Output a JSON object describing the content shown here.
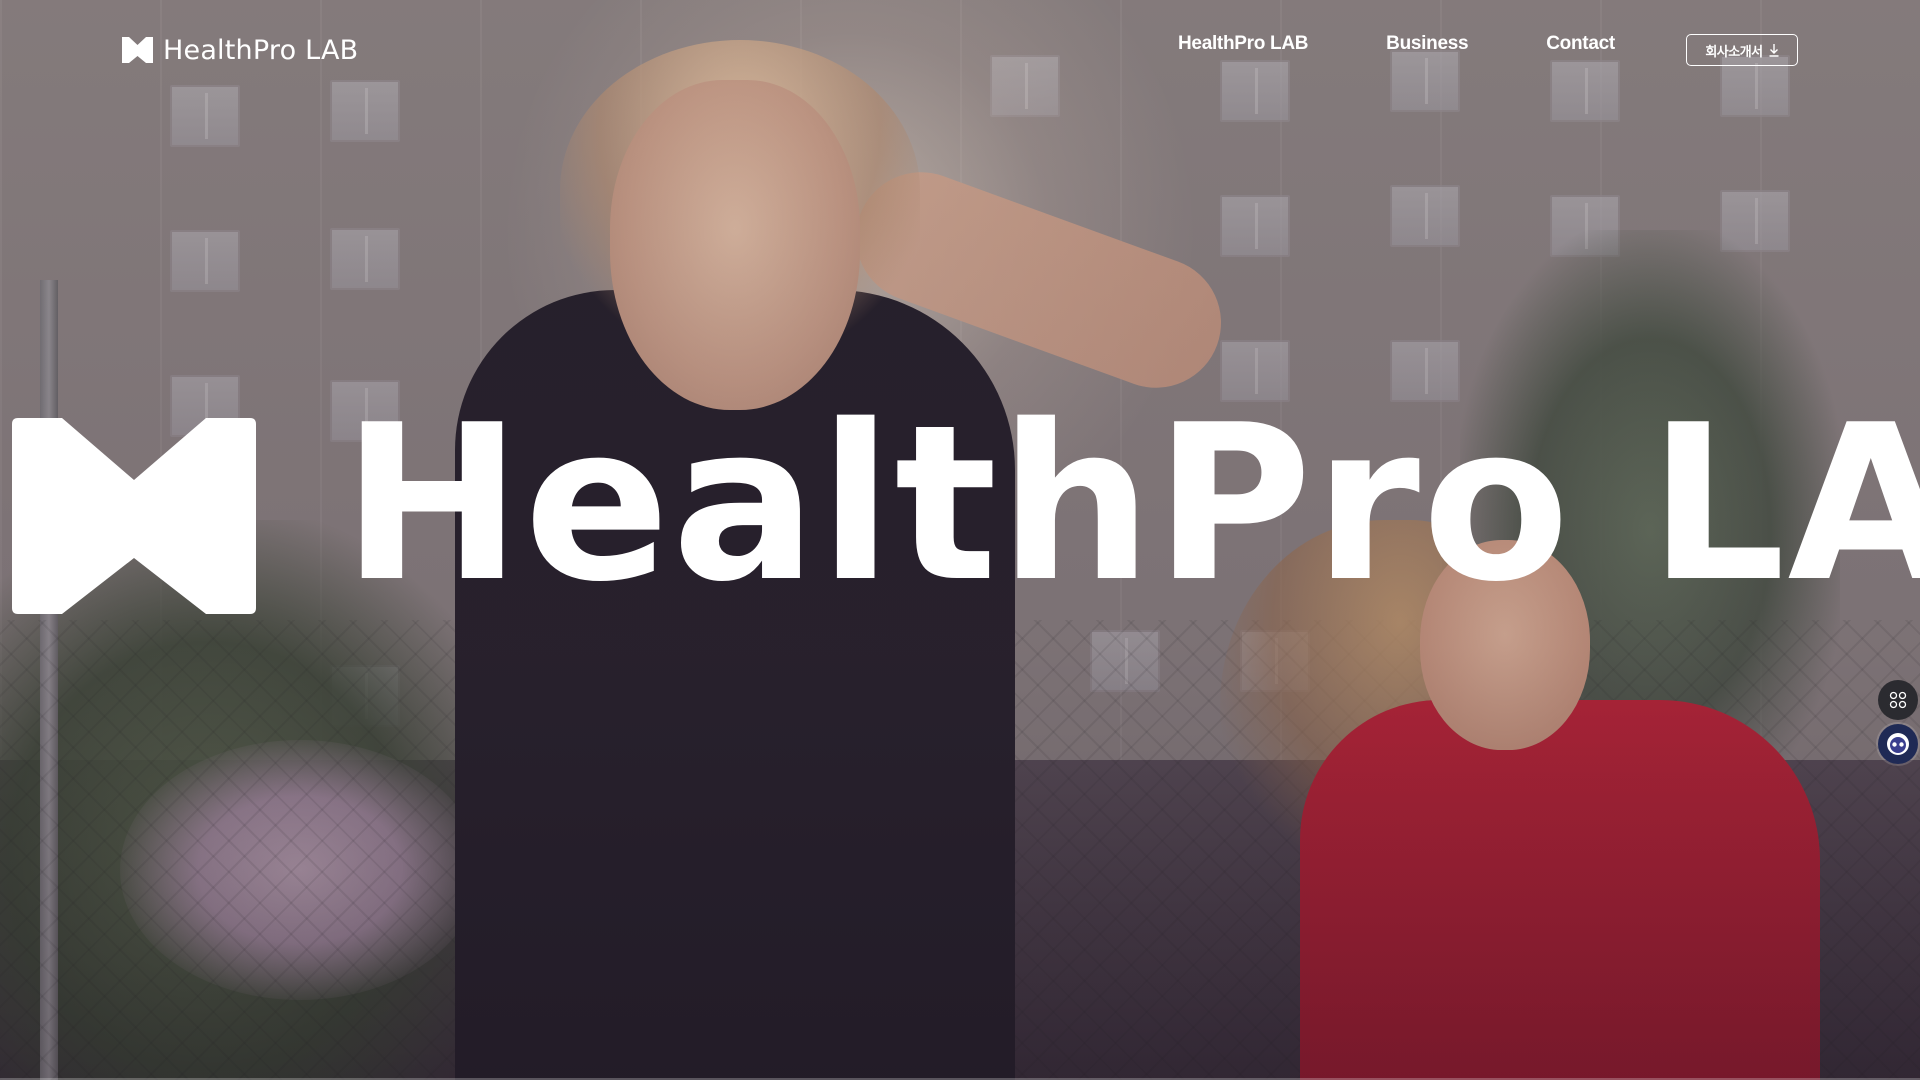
{
  "brand": {
    "name": "HealthPro LAB",
    "icon": "healthpro-logo-icon"
  },
  "nav": {
    "items": [
      {
        "label": "HealthPro LAB"
      },
      {
        "label": "Business"
      },
      {
        "label": "Contact"
      }
    ],
    "download_label": "회사소개서",
    "download_icon": "download-arrow-icon"
  },
  "hero": {
    "wordmark": "HealthPro LAB",
    "icon": "healthpro-logo-icon"
  },
  "side_widgets": {
    "apps_icon": "apps-grid-icon",
    "chatbot_icon": "chatbot-icon"
  },
  "colors": {
    "text": "#ffffff",
    "chatbot_bg": "#1f2a55",
    "apps_bg": "#2b2b30"
  }
}
